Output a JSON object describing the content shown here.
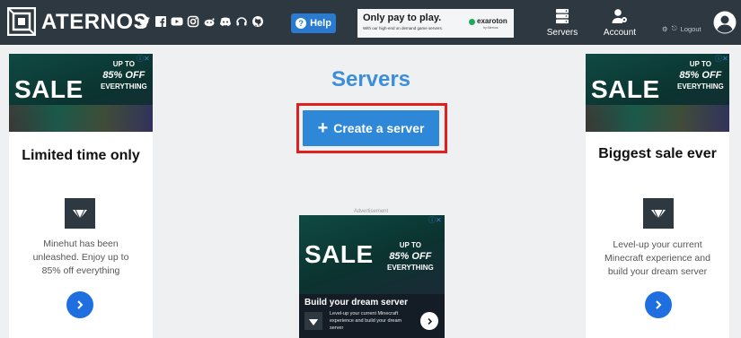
{
  "header": {
    "brand": "ATERNOS",
    "help_label": "Help",
    "social_icons": [
      "twitter-icon",
      "facebook-icon",
      "youtube-icon",
      "instagram-icon",
      "reddit-icon",
      "discord-icon",
      "teamspeak-icon",
      "github-icon"
    ],
    "top_ad": {
      "headline": "Only pay to play.",
      "subtext": "With our high-end on demand game servers.",
      "brand": "exaroton",
      "brand_sub": "by Aternos"
    },
    "nav": {
      "servers_label": "Servers",
      "account_label": "Account",
      "logout_label": "Logout"
    }
  },
  "left_ad": {
    "sale": "SALE",
    "upto": "UP TO",
    "percent": "85% OFF",
    "everything": "EVERYTHING",
    "headline": "Limited time only",
    "description": "Minehut has been unleashed. Enjoy up to 85% off everything"
  },
  "main": {
    "title": "Servers",
    "create_label": "Create a server",
    "advertisement_label": "Advertisement",
    "mid_ad": {
      "sale": "SALE",
      "upto": "UP TO",
      "percent": "85% OFF",
      "everything": "EVERYTHING",
      "headline": "Build your dream server",
      "description": "Level-up your current Minecraft experience and build your dream server"
    }
  },
  "right_ad": {
    "sale": "SALE",
    "upto": "UP TO",
    "percent": "85% OFF",
    "everything": "EVERYTHING",
    "headline": "Biggest sale ever",
    "description": "Level-up your current Minecraft experience and build your dream server"
  },
  "colors": {
    "topbar": "#2e3840",
    "accent_blue": "#2f87d8",
    "title_blue": "#3d8ed8",
    "highlight_red": "#e0201f"
  }
}
